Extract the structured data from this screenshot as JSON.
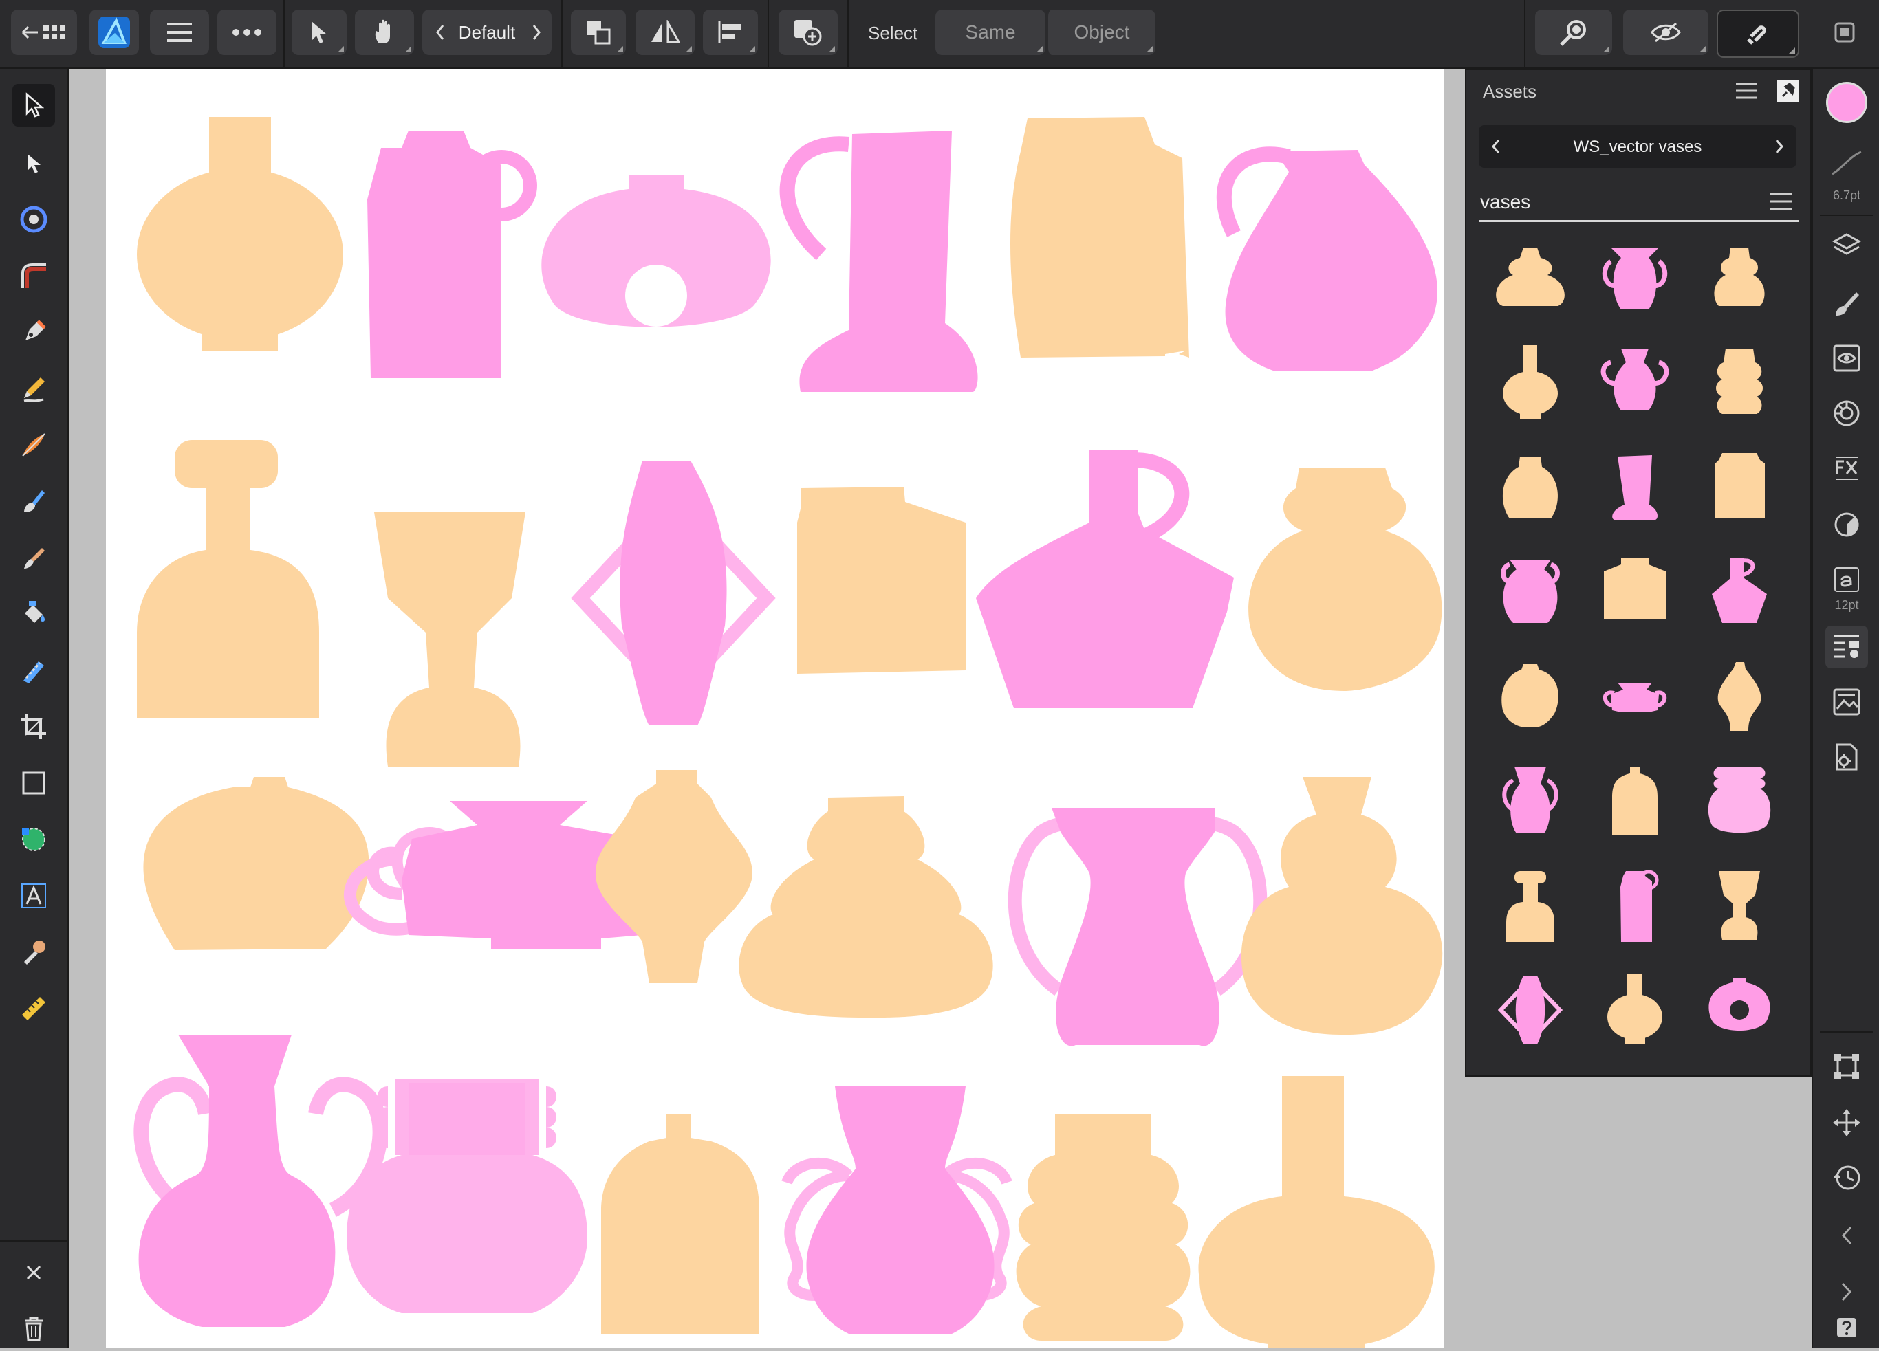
{
  "toolbar": {
    "persona_label": "Default",
    "select_label": "Select",
    "same_label": "Same",
    "object_label": "Object"
  },
  "assets_panel": {
    "title": "Assets",
    "library_name": "WS_vector vases",
    "category": "vases"
  },
  "right_rail": {
    "stroke_width": "6.7pt",
    "font_size": "12pt"
  },
  "colors": {
    "peach": "#fdd5a0",
    "pink": "#ff9de6",
    "light_pink": "#ffb3eb",
    "ui_bg": "#2b2b2d"
  }
}
